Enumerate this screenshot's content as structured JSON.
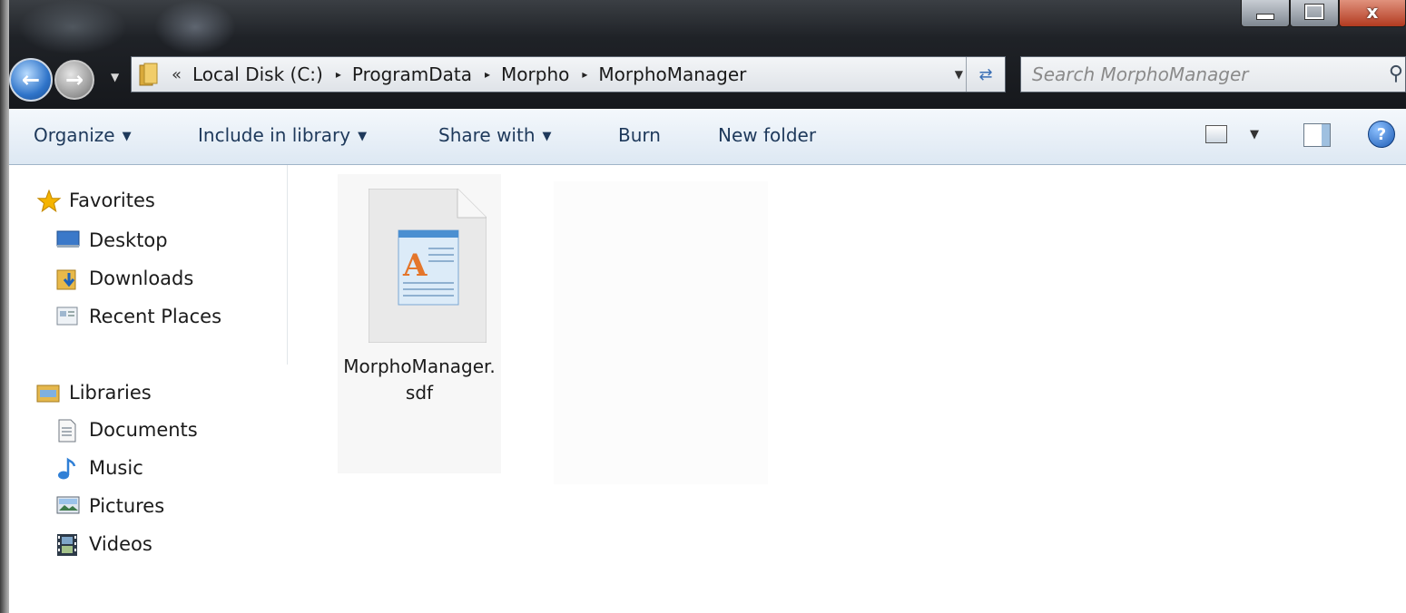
{
  "window": {
    "caption": {
      "minimize_icon": "minimize-icon",
      "maximize_icon": "maximize-icon",
      "close_label": "x"
    }
  },
  "navigation": {
    "back_icon": "back-arrow-icon",
    "forward_icon": "forward-arrow-icon",
    "address": {
      "overflow_label": "«",
      "crumbs": [
        "Local Disk (C:)",
        "ProgramData",
        "Morpho",
        "MorphoManager"
      ],
      "separator_glyph": "▸"
    },
    "search": {
      "placeholder": "Search MorphoManager"
    }
  },
  "command_bar": {
    "organize": "Organize",
    "include_in_library": "Include in library",
    "share_with": "Share with",
    "burn": "Burn",
    "new_folder": "New folder",
    "dropdown_glyph": "▼",
    "help_glyph": "?"
  },
  "sidebar": {
    "favorites": {
      "label": "Favorites",
      "items": [
        "Desktop",
        "Downloads",
        "Recent Places"
      ]
    },
    "libraries": {
      "label": "Libraries",
      "items": [
        "Documents",
        "Music",
        "Pictures",
        "Videos"
      ]
    }
  },
  "files": [
    {
      "name_line1": "MorphoManager.",
      "name_line2": "sdf",
      "icon": "sdf-document-icon"
    }
  ],
  "colors": {
    "command_text": "#1e395b",
    "accent_blue": "#2f74c9",
    "star_yellow": "#f5b400"
  }
}
